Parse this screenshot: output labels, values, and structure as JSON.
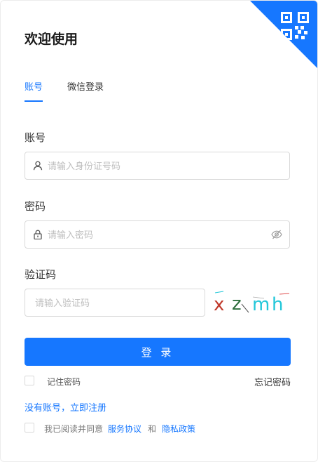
{
  "title": "欢迎使用",
  "tabs": [
    {
      "label": "账号"
    },
    {
      "label": "微信登录"
    }
  ],
  "account": {
    "label": "账号",
    "placeholder": "请输入身份证号码"
  },
  "password": {
    "label": "密码",
    "placeholder": "请输入密码"
  },
  "captcha": {
    "label": "验证码",
    "placeholder": "请输入验证码",
    "chars": [
      "x",
      "z",
      "m",
      "h"
    ],
    "colors": [
      "#c0392b",
      "#2f6f3e",
      "#23c7d9",
      "#23c7d9"
    ]
  },
  "login_label": "登 录",
  "remember_label": "记住密码",
  "forgot_label": "忘记密码",
  "register_label": "没有账号，立即注册",
  "agreement": {
    "prefix": "我已阅读并同意",
    "service": "服务协议",
    "and": "和",
    "privacy": "隐私政策"
  },
  "accent": "#1677ff"
}
